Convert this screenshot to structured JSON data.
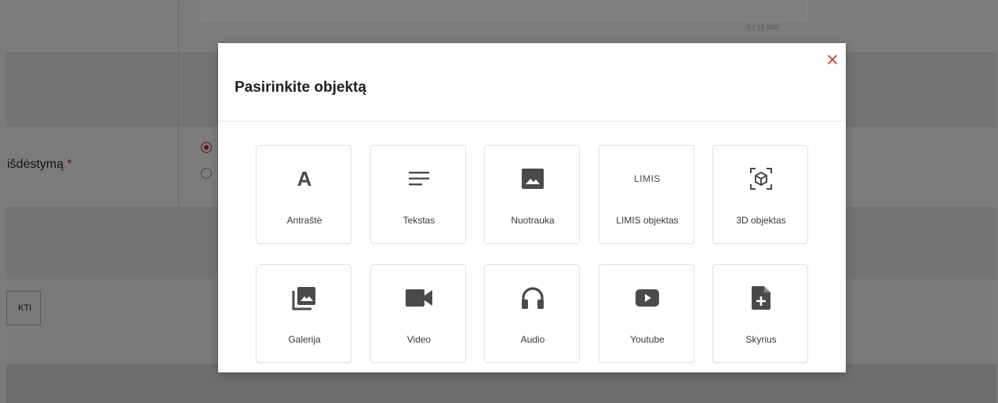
{
  "background": {
    "char_counter": "0 / 15 000",
    "layout_label": "išdėstymą",
    "required_mark": "*",
    "button_label": "KTI"
  },
  "modal": {
    "title": "Pasirinkite objektą",
    "close_icon": "close-icon",
    "items": [
      {
        "label": "Antraštė",
        "icon": "heading-icon",
        "glyph": "A"
      },
      {
        "label": "Tekstas",
        "icon": "text-lines-icon"
      },
      {
        "label": "Nuotrauka",
        "icon": "image-icon"
      },
      {
        "label": "LIMIS objektas",
        "icon": "limis-icon",
        "glyph": "LIMIS"
      },
      {
        "label": "3D objektas",
        "icon": "cube-3d-icon"
      },
      {
        "label": "Galerija",
        "icon": "gallery-icon"
      },
      {
        "label": "Video",
        "icon": "video-camera-icon"
      },
      {
        "label": "Audio",
        "icon": "headphones-icon"
      },
      {
        "label": "Youtube",
        "icon": "youtube-play-icon"
      },
      {
        "label": "Skyrius",
        "icon": "add-file-icon"
      }
    ]
  },
  "colors": {
    "overlay": "#7b7b7b",
    "accent_red": "#c0392b",
    "icon_gray": "#4a4a4a"
  }
}
